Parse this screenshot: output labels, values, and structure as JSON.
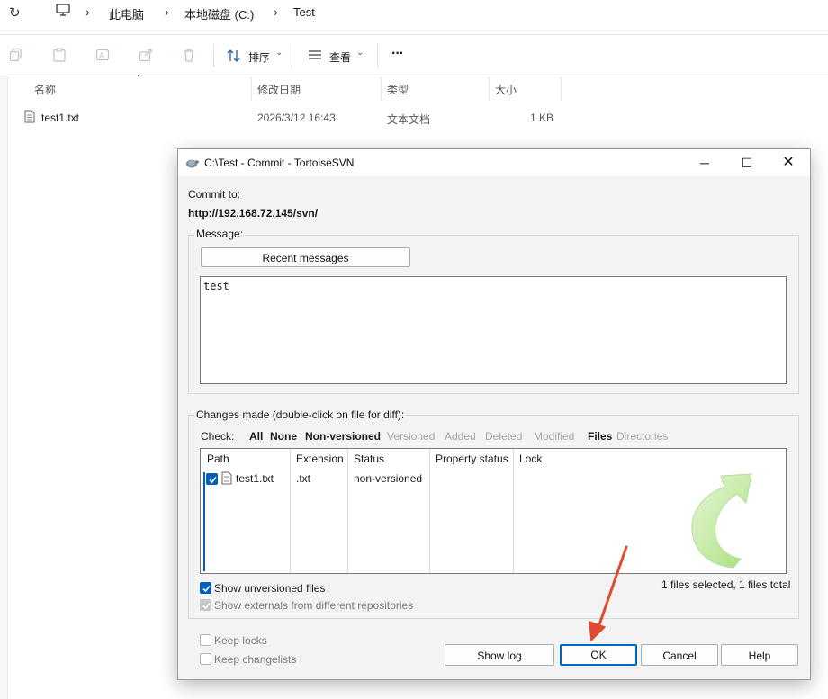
{
  "explorer": {
    "breadcrumb": [
      "此电脑",
      "本地磁盘 (C:)",
      "Test"
    ],
    "toolbar": {
      "sort_label": "排序",
      "view_label": "查看",
      "more_label": "···"
    },
    "columns": [
      "名称",
      "修改日期",
      "类型",
      "大小"
    ],
    "files": [
      {
        "name": "test1.txt",
        "modified": "2026/3/12 16:43",
        "type": "文本文档",
        "size": "1 KB"
      }
    ]
  },
  "dialog": {
    "title": "C:\\Test - Commit - TortoiseSVN",
    "commit_to_label": "Commit to:",
    "commit_url": "http://192.168.72.145/svn/",
    "message_group_label": "Message:",
    "recent_messages_button": "Recent messages",
    "message_text": "test",
    "changes_group_label": "Changes made (double-click on file for diff):",
    "check_label": "Check:",
    "check_filters": [
      {
        "label": "All",
        "enabled": true
      },
      {
        "label": "None",
        "enabled": true
      },
      {
        "label": "Non-versioned",
        "enabled": true
      },
      {
        "label": "Versioned",
        "enabled": false
      },
      {
        "label": "Added",
        "enabled": false
      },
      {
        "label": "Deleted",
        "enabled": false
      },
      {
        "label": "Modified",
        "enabled": false
      },
      {
        "label": "Files",
        "enabled": true
      },
      {
        "label": "Directories",
        "enabled": false
      }
    ],
    "list_columns": [
      "Path",
      "Extension",
      "Status",
      "Property status",
      "Lock"
    ],
    "list_rows": [
      {
        "checked": true,
        "path": "test1.txt",
        "extension": ".txt",
        "status": "non-versioned",
        "property_status": "",
        "lock": ""
      }
    ],
    "show_unversioned_label": "Show unversioned files",
    "show_unversioned_checked": true,
    "show_externals_label": "Show externals from different repositories",
    "show_externals_checked": true,
    "show_externals_enabled": false,
    "selection_summary": "1 files selected, 1 files total",
    "keep_locks_label": "Keep locks",
    "keep_changelists_label": "Keep changelists",
    "buttons": {
      "show_log": "Show log",
      "ok": "OK",
      "cancel": "Cancel",
      "help": "Help"
    },
    "colors": {
      "accent": "#005fb8",
      "annotation_arrow": "#e04a2f",
      "watermark_arrow": "#a8e07a"
    }
  }
}
